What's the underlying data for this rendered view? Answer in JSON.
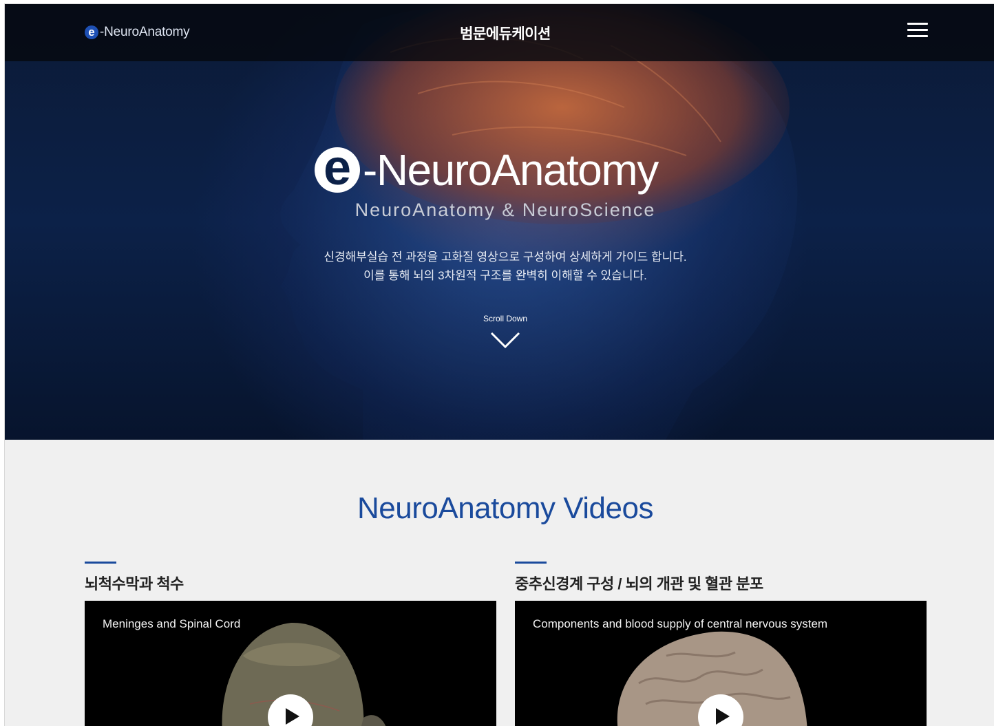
{
  "header": {
    "brand_letter": "e",
    "brand_text": "-NeuroAnatomy",
    "center_title": "범문에듀케이션",
    "menu_icon": "hamburger-icon"
  },
  "hero": {
    "logo_letter": "e",
    "logo_word": "-NeuroAnatomy",
    "subtitle": "NeuroAnatomy & NeuroScience",
    "desc_line1": "신경해부실습 전 과정을 고화질 영상으로 구성하여 상세하게 가이드 합니다.",
    "desc_line2": "이를 통해 뇌의 3차원적 구조를 완벽히 이해할 수 있습니다.",
    "scroll_label": "Scroll Down",
    "scroll_icon": "chevron-down-icon"
  },
  "section": {
    "title": "NeuroAnatomy Videos",
    "accent_color": "#1a4a9c",
    "videos": [
      {
        "heading": "뇌척수막과 척수",
        "caption": "Meninges and Spinal Cord",
        "icon": "play-icon"
      },
      {
        "heading": "중추신경계 구성 / 뇌의 개관 및 혈관 분포",
        "caption": "Components and blood supply of central nervous system",
        "icon": "play-icon"
      }
    ]
  }
}
